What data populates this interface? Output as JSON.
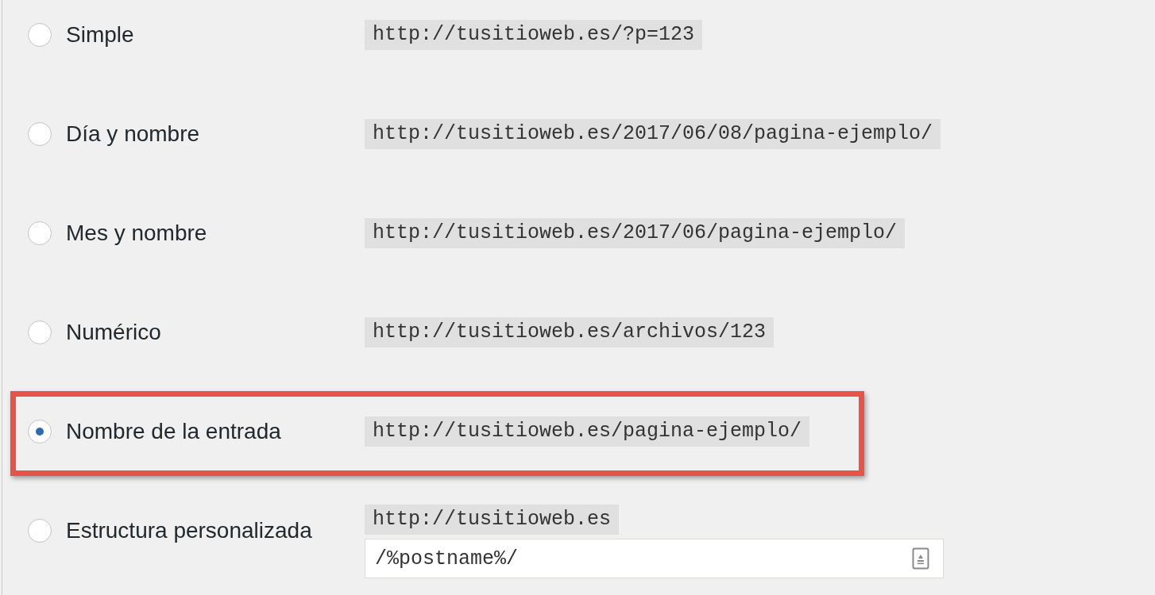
{
  "options": [
    {
      "kind": "plain",
      "label": "Simple",
      "example": "http://tusitioweb.es/?p=123",
      "selected": false,
      "highlighted": false
    },
    {
      "kind": "plain",
      "label": "Día y nombre",
      "example": "http://tusitioweb.es/2017/06/08/pagina-ejemplo/",
      "selected": false,
      "highlighted": false
    },
    {
      "kind": "plain",
      "label": "Mes y nombre",
      "example": "http://tusitioweb.es/2017/06/pagina-ejemplo/",
      "selected": false,
      "highlighted": false
    },
    {
      "kind": "plain",
      "label": "Numérico",
      "example": "http://tusitioweb.es/archivos/123",
      "selected": false,
      "highlighted": false
    },
    {
      "kind": "plain",
      "label": "Nombre de la entrada",
      "example": "http://tusitioweb.es/pagina-ejemplo/",
      "selected": true,
      "highlighted": true
    },
    {
      "kind": "custom",
      "label": "Estructura personalizada",
      "example": "http://tusitioweb.es",
      "value": "/%postname%/",
      "selected": false,
      "highlighted": false
    }
  ]
}
